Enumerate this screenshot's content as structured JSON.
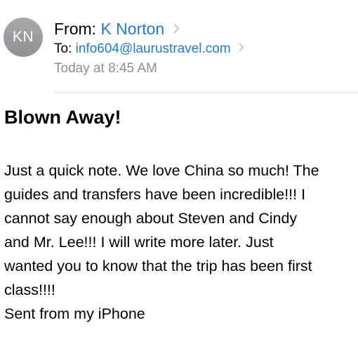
{
  "sender": {
    "initials": "KN",
    "from_label": "From:",
    "from_name": "K Norton",
    "to_label": "To:",
    "to_address": "info604@laurustravel.com",
    "timestamp": "Today at 8:45 AM"
  },
  "message": {
    "subject": "Blown Away!",
    "body_lines": [
      "Just a quick note. We love China so much! The",
      "guides and transfers have been incredible!!! I",
      "cannot say enough about Steven and Cindy",
      "and Mr. Lee!!! I will write more later. Just",
      "wanted you to know that the trip has been first",
      "class!!!!",
      "Sent from my iPhone"
    ]
  },
  "colors": {
    "link": "#1f7ae0",
    "secondary_text": "#8e8e93",
    "avatar": "#9a9ca0"
  },
  "icons": [
    "chevron-right-icon"
  ]
}
